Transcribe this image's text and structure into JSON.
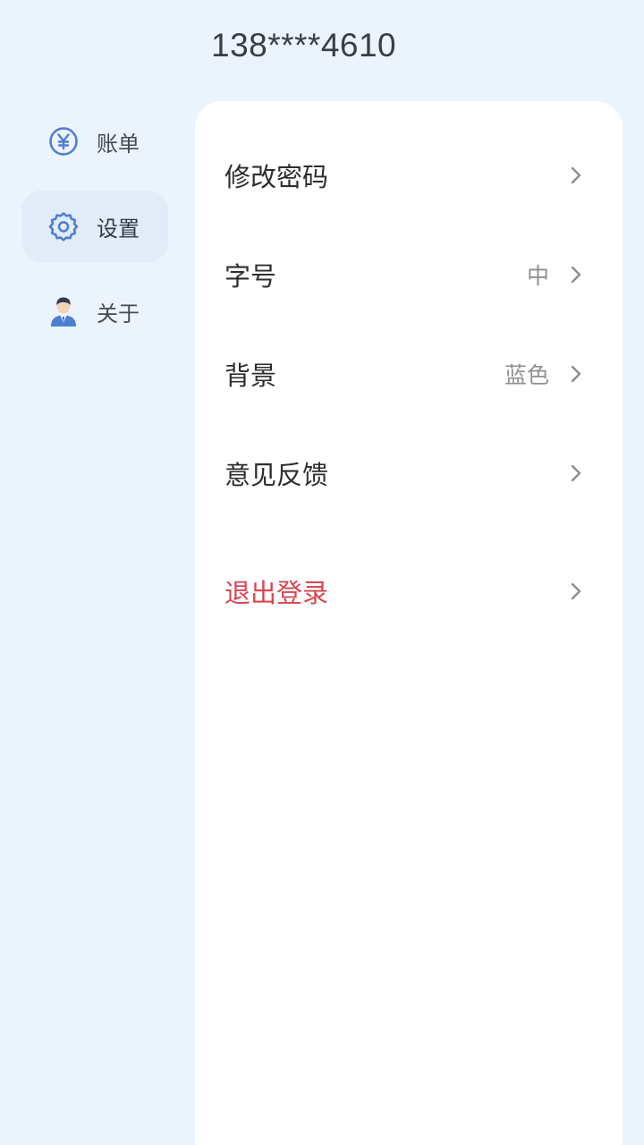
{
  "header": {
    "phone": "138****4610"
  },
  "sidebar": {
    "items": [
      {
        "label": "账单",
        "icon": "yuan-circle-icon",
        "active": false
      },
      {
        "label": "设置",
        "icon": "gear-icon",
        "active": true
      },
      {
        "label": "关于",
        "icon": "person-icon",
        "active": false
      }
    ]
  },
  "settings": {
    "items": [
      {
        "label": "修改密码",
        "value": ""
      },
      {
        "label": "字号",
        "value": "中"
      },
      {
        "label": "背景",
        "value": "蓝色"
      },
      {
        "label": "意见反馈",
        "value": ""
      }
    ],
    "logout_label": "退出登录"
  },
  "colors": {
    "background": "#ebf4fd",
    "accent_blue": "#4a7fd4",
    "danger": "#d9454f"
  }
}
